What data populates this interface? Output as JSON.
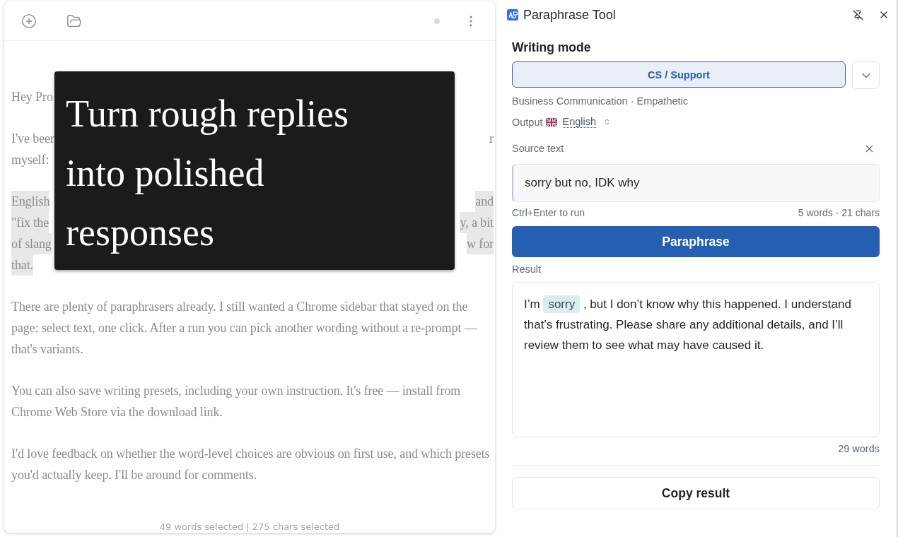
{
  "editor": {
    "status": "49 words selected | 275 chars selected",
    "paragraphs": [
      {
        "kind": "covered",
        "selected": false,
        "lines": [
          {
            "left": "Hey Pro"
          }
        ]
      },
      {
        "kind": "covered",
        "selected": false,
        "lines": [
          {
            "left": "I've beer",
            "right": "r"
          },
          {
            "left": "myself:"
          }
        ]
      },
      {
        "kind": "covered",
        "selected": true,
        "lines": [
          {
            "left": "English",
            "right": "and"
          },
          {
            "left": "\"fix the",
            "right": "y, a bit"
          },
          {
            "left": "of slang",
            "right": "w for"
          },
          {
            "left": "that."
          }
        ]
      },
      {
        "kind": "text",
        "selected": false,
        "text": "There are plenty of paraphrasers already. I still wanted a Chrome sidebar that stayed on the page: select text, one click. After a run you can pick another wording without a re-prompt — that's variants."
      },
      {
        "kind": "text",
        "selected": false,
        "text": "You can also save writing presets, including your own instruction. It's free — install from Chrome Web Store via the download link."
      },
      {
        "kind": "text",
        "selected": false,
        "text": "I'd love feedback on whether the word-level choices are obvious on first use, and which presets you'd actually keep. I'll be around for comments."
      }
    ]
  },
  "overlay": {
    "text": "Turn rough replies into polished responses"
  },
  "panel": {
    "title": "Paraphrase Tool",
    "writing_mode_label": "Writing mode",
    "mode": "CS / Support",
    "mode_detail": "Business Communication · Empathetic",
    "output_label": "Output",
    "language": "English",
    "source_label": "Source text",
    "source_value": "sorry but no, IDK why",
    "hint": "Ctrl+Enter to run",
    "source_count": "5 words · 21 chars",
    "run_button": "Paraphrase",
    "result_label": "Result",
    "result": [
      {
        "text": "I’m ",
        "highlighted": false
      },
      {
        "text": "sorry",
        "highlighted": true
      },
      {
        "text": " , but I don’t know why this happened. I understand that’s frustrating. Please share any additional details, and I’ll review them to see what may have caused it.",
        "highlighted": false
      }
    ],
    "result_count": "29 words",
    "copy_button": "Copy result"
  }
}
